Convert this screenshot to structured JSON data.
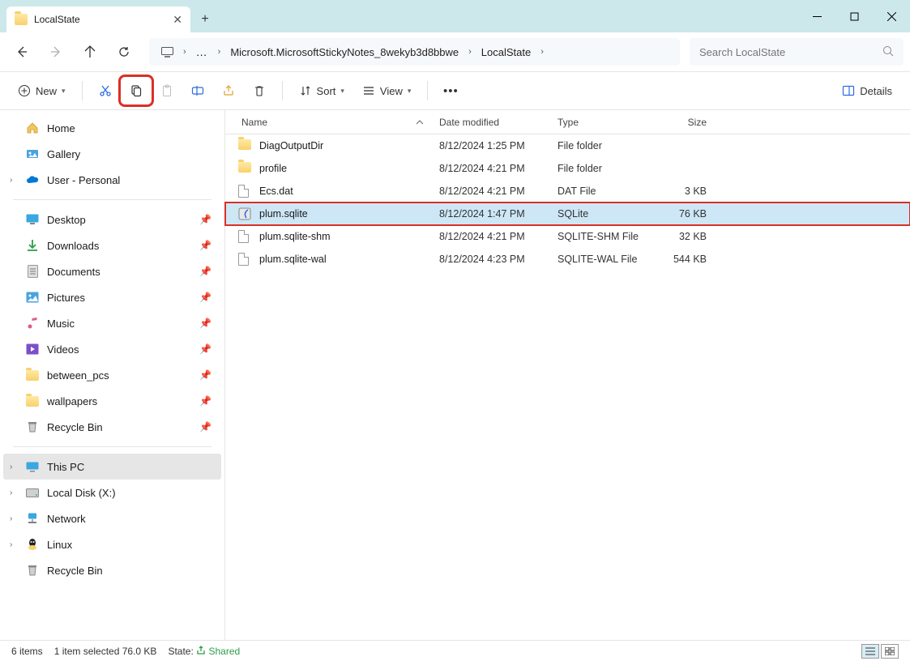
{
  "window": {
    "tab_title": "LocalState"
  },
  "nav": {
    "breadcrumb": [
      "Microsoft.MicrosoftStickyNotes_8wekyb3d8bbwe",
      "LocalState"
    ],
    "search_placeholder": "Search LocalState"
  },
  "toolbar": {
    "new_label": "New",
    "sort_label": "Sort",
    "view_label": "View",
    "details_label": "Details"
  },
  "sidebar": {
    "home": "Home",
    "gallery": "Gallery",
    "user": "User - Personal",
    "quick": [
      {
        "label": "Desktop",
        "icon": "desktop"
      },
      {
        "label": "Downloads",
        "icon": "downloads"
      },
      {
        "label": "Documents",
        "icon": "documents"
      },
      {
        "label": "Pictures",
        "icon": "pictures"
      },
      {
        "label": "Music",
        "icon": "music"
      },
      {
        "label": "Videos",
        "icon": "videos"
      },
      {
        "label": "between_pcs",
        "icon": "folder"
      },
      {
        "label": "wallpapers",
        "icon": "folder"
      },
      {
        "label": "Recycle Bin",
        "icon": "recycle"
      }
    ],
    "drives": [
      {
        "label": "This PC",
        "icon": "pc",
        "selected": true,
        "expandable": true
      },
      {
        "label": "Local Disk (X:)",
        "icon": "disk",
        "expandable": true
      },
      {
        "label": "Network",
        "icon": "network",
        "expandable": true
      },
      {
        "label": "Linux",
        "icon": "linux",
        "expandable": true
      },
      {
        "label": "Recycle Bin",
        "icon": "recycle",
        "expandable": false
      }
    ]
  },
  "columns": {
    "name": "Name",
    "date": "Date modified",
    "type": "Type",
    "size": "Size"
  },
  "files": [
    {
      "name": "DiagOutputDir",
      "date": "8/12/2024 1:25 PM",
      "type": "File folder",
      "size": "",
      "icon": "folder"
    },
    {
      "name": "profile",
      "date": "8/12/2024 4:21 PM",
      "type": "File folder",
      "size": "",
      "icon": "folder"
    },
    {
      "name": "Ecs.dat",
      "date": "8/12/2024 4:21 PM",
      "type": "DAT File",
      "size": "3 KB",
      "icon": "file"
    },
    {
      "name": "plum.sqlite",
      "date": "8/12/2024 1:47 PM",
      "type": "SQLite",
      "size": "76 KB",
      "icon": "sqlite",
      "selected": true,
      "highlighted": true
    },
    {
      "name": "plum.sqlite-shm",
      "date": "8/12/2024 4:21 PM",
      "type": "SQLITE-SHM File",
      "size": "32 KB",
      "icon": "file"
    },
    {
      "name": "plum.sqlite-wal",
      "date": "8/12/2024 4:23 PM",
      "type": "SQLITE-WAL File",
      "size": "544 KB",
      "icon": "file"
    }
  ],
  "status": {
    "count": "6 items",
    "selection": "1 item selected  76.0 KB",
    "state_label": "State:",
    "state_value": "Shared"
  }
}
